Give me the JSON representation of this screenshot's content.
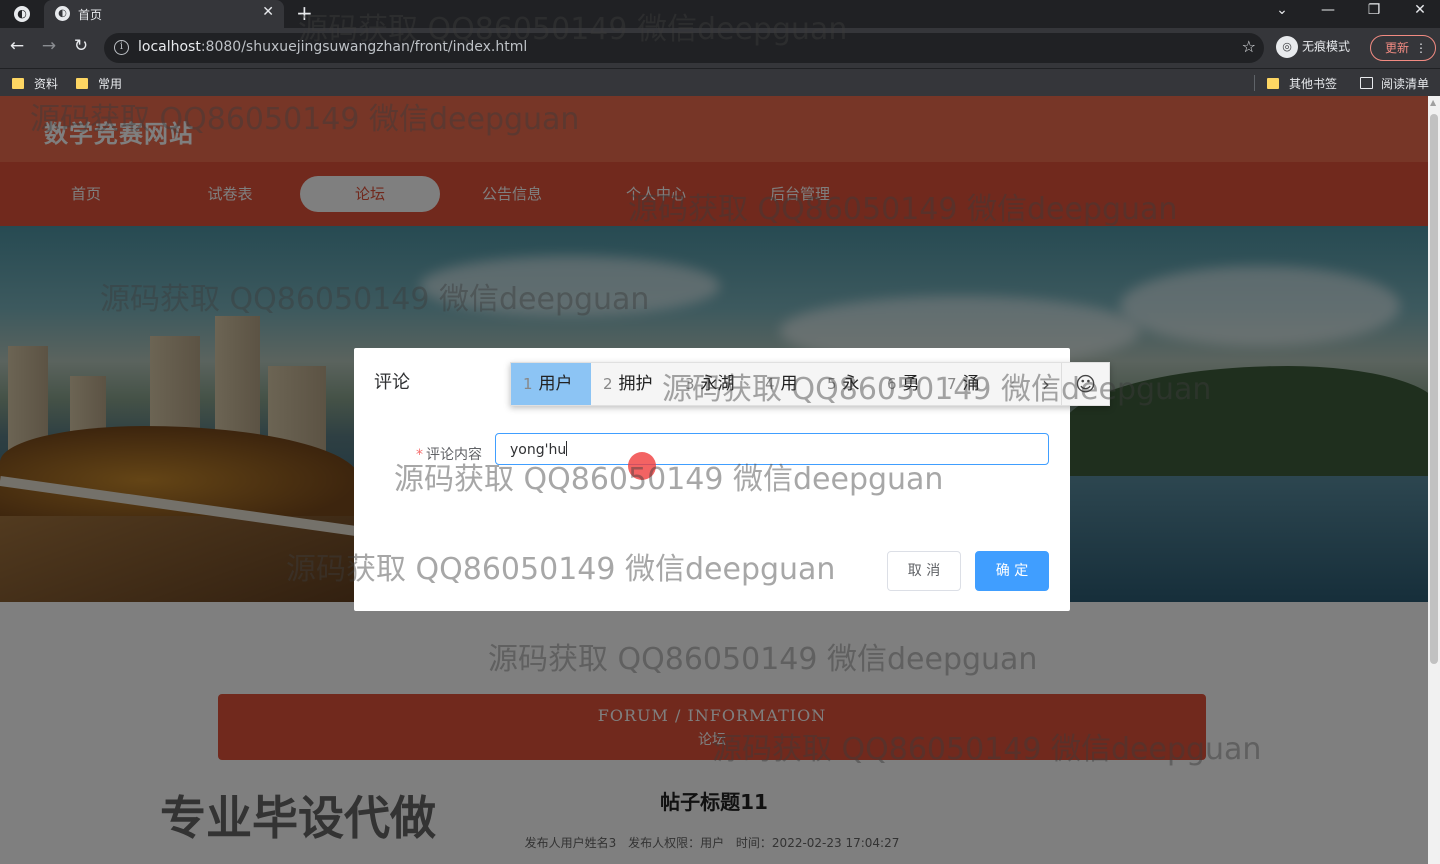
{
  "browser": {
    "tab_title": "首页",
    "url_host": "localhost",
    "url_rest": ":8080/shuxuejingsuwangzhan/front/index.html",
    "incognito_label": "无痕模式",
    "update_label": "更新",
    "bookmarks": [
      "资料",
      "常用"
    ],
    "other_bookmarks": "其他书签",
    "reading_list": "阅读清单"
  },
  "site": {
    "title": "数学竞赛网站",
    "nav": [
      {
        "label": "首页",
        "active": false
      },
      {
        "label": "试卷表",
        "active": false
      },
      {
        "label": "论坛",
        "active": true
      },
      {
        "label": "公告信息",
        "active": false
      },
      {
        "label": "个人中心",
        "active": false
      },
      {
        "label": "后台管理",
        "active": false
      }
    ]
  },
  "forum": {
    "heading_en": "FORUM / INFORMATION",
    "heading_cn": "论坛",
    "post_title": "帖子标题11",
    "meta": {
      "publisher": "发布人用户姓名3",
      "role": "发布人权限：用户",
      "time": "时间：2022-02-23 17:04:27"
    }
  },
  "dialog": {
    "title": "评论",
    "field_label": "评论内容",
    "field_value": "yong'hu",
    "cancel_label": "取 消",
    "confirm_label": "确 定"
  },
  "ime": {
    "candidates": [
      {
        "num": "1",
        "text": "用户"
      },
      {
        "num": "2",
        "text": "拥护"
      },
      {
        "num": "3",
        "text": "永湖"
      },
      {
        "num": "4",
        "text": "用"
      },
      {
        "num": "5",
        "text": "永"
      },
      {
        "num": "6",
        "text": "勇"
      },
      {
        "num": "7",
        "text": "涌"
      }
    ],
    "selected_index": 0
  },
  "watermark": "源码获取 QQ86050149 微信deepguan",
  "promo_text": "专业毕设代做",
  "colors": {
    "header": "#ef6c4e",
    "nav": "#e3533a",
    "primary_button": "#409eff"
  }
}
